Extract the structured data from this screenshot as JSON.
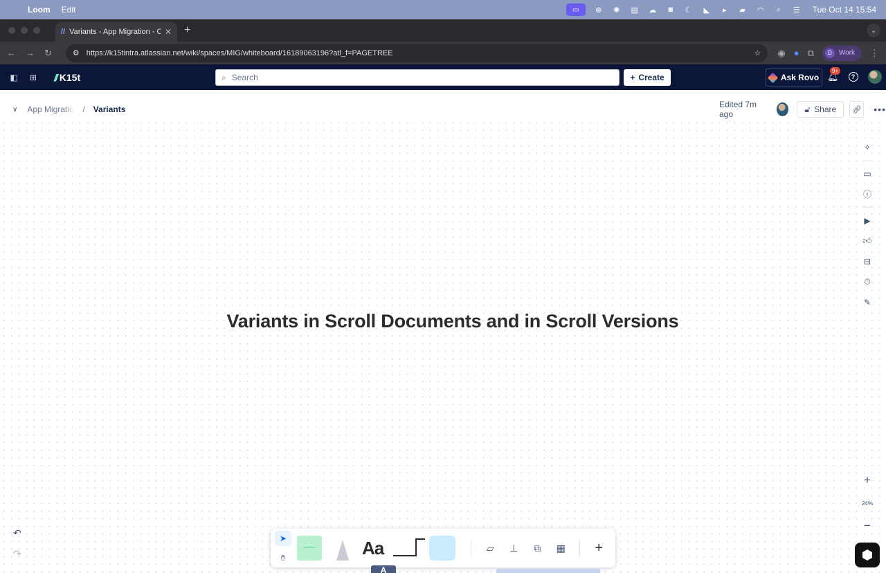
{
  "menubar": {
    "app_name": "Loom",
    "menu_edit": "Edit",
    "clock": "Tue Oct 14  15:54"
  },
  "browser": {
    "tab_title": "Variants - App Migration - Co",
    "url": "https://k15tintra.atlassian.net/wiki/spaces/MIG/whiteboard/16189063196?atl_f=PAGETREE",
    "profile_initial": "D",
    "profile_label": "Work"
  },
  "topnav": {
    "logo_text": "K15t",
    "search_placeholder": "Search",
    "create_label": "Create",
    "rovo_label": "Ask Rovo",
    "notification_badge": "9+"
  },
  "page": {
    "breadcrumb_parent": "App Migration",
    "breadcrumb_separator": "/",
    "breadcrumb_current": "Variants",
    "edited": "Edited 7m ago",
    "share_label": "Share"
  },
  "whiteboard": {
    "heading": "Variants in Scroll Documents and in Scroll Versions",
    "zoom_level": "24%"
  },
  "toolbar": {
    "text_tool_label": "Aa"
  },
  "peek": {
    "glyph": "A"
  }
}
